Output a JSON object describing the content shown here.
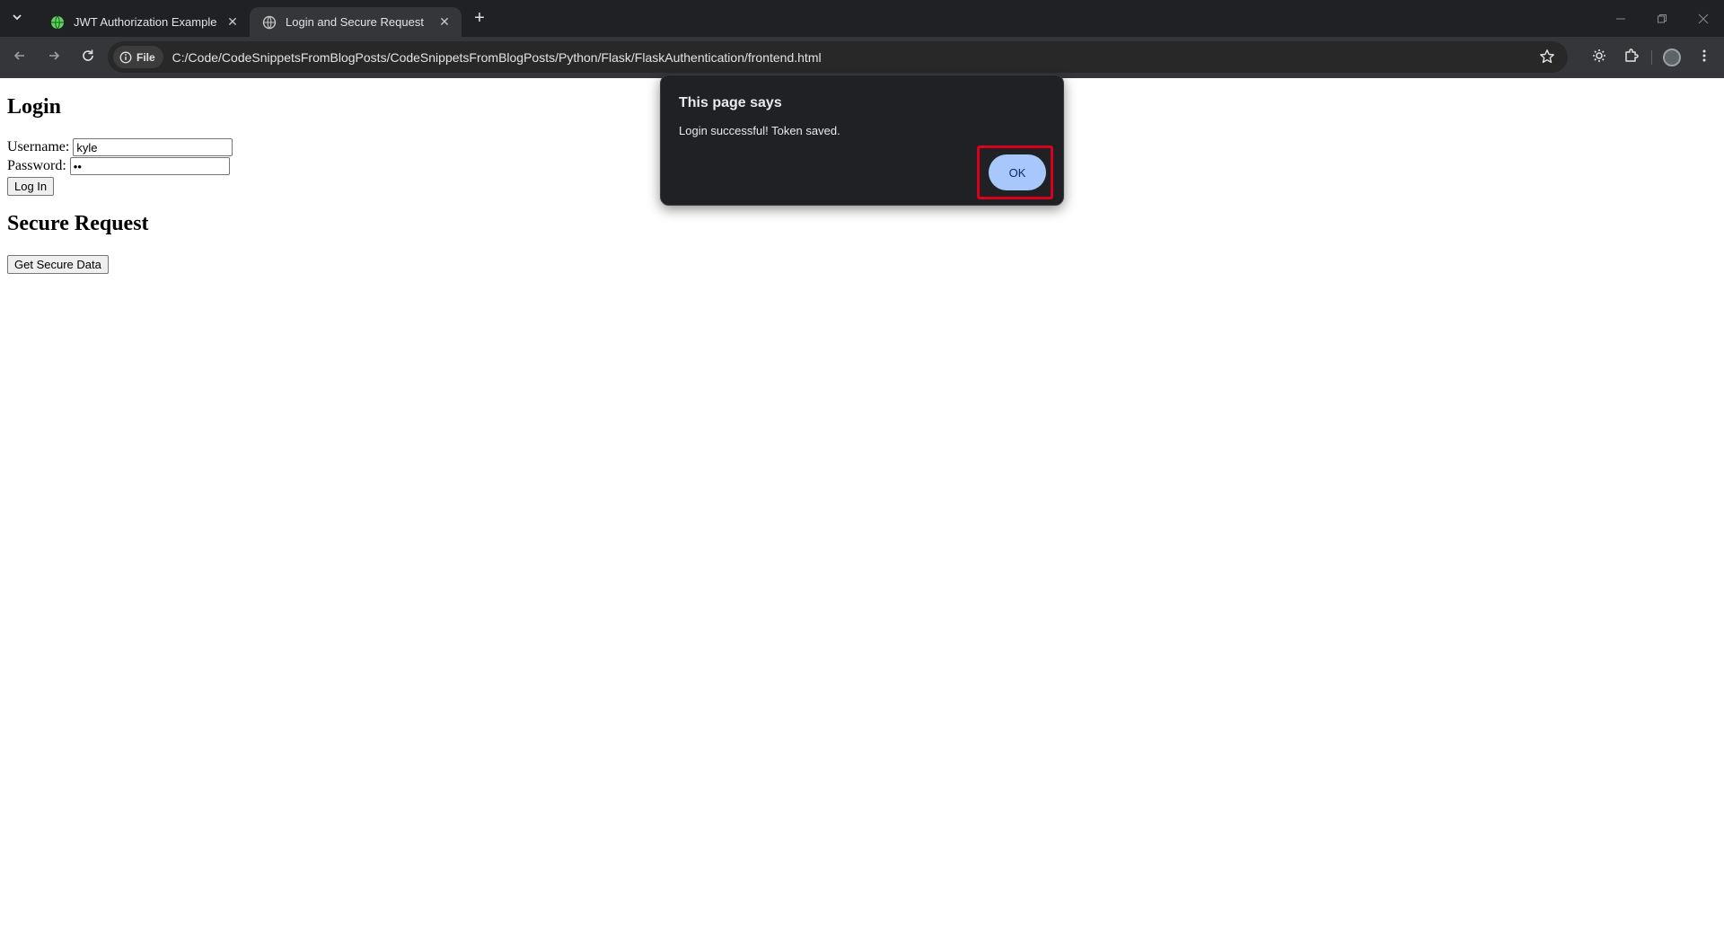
{
  "browser": {
    "tabs": [
      {
        "title": "JWT Authorization Example",
        "active": false
      },
      {
        "title": "Login and Secure Request",
        "active": true
      }
    ],
    "address": {
      "chip_label": "File",
      "url": "C:/Code/CodeSnippetsFromBlogPosts/CodeSnippetsFromBlogPosts/Python/Flask/FlaskAuthentication/frontend.html"
    },
    "colors": {
      "frame": "#202124",
      "toolbar": "#35363a",
      "accent": "#a8c7fa"
    }
  },
  "page": {
    "login_heading": "Login",
    "username_label": "Username:",
    "username_value": "kyle",
    "password_label": "Password:",
    "password_value": "••",
    "login_button": "Log In",
    "secure_heading": "Secure Request",
    "secure_button": "Get Secure Data"
  },
  "dialog": {
    "title": "This page says",
    "message": "Login successful! Token saved.",
    "ok_label": "OK"
  }
}
